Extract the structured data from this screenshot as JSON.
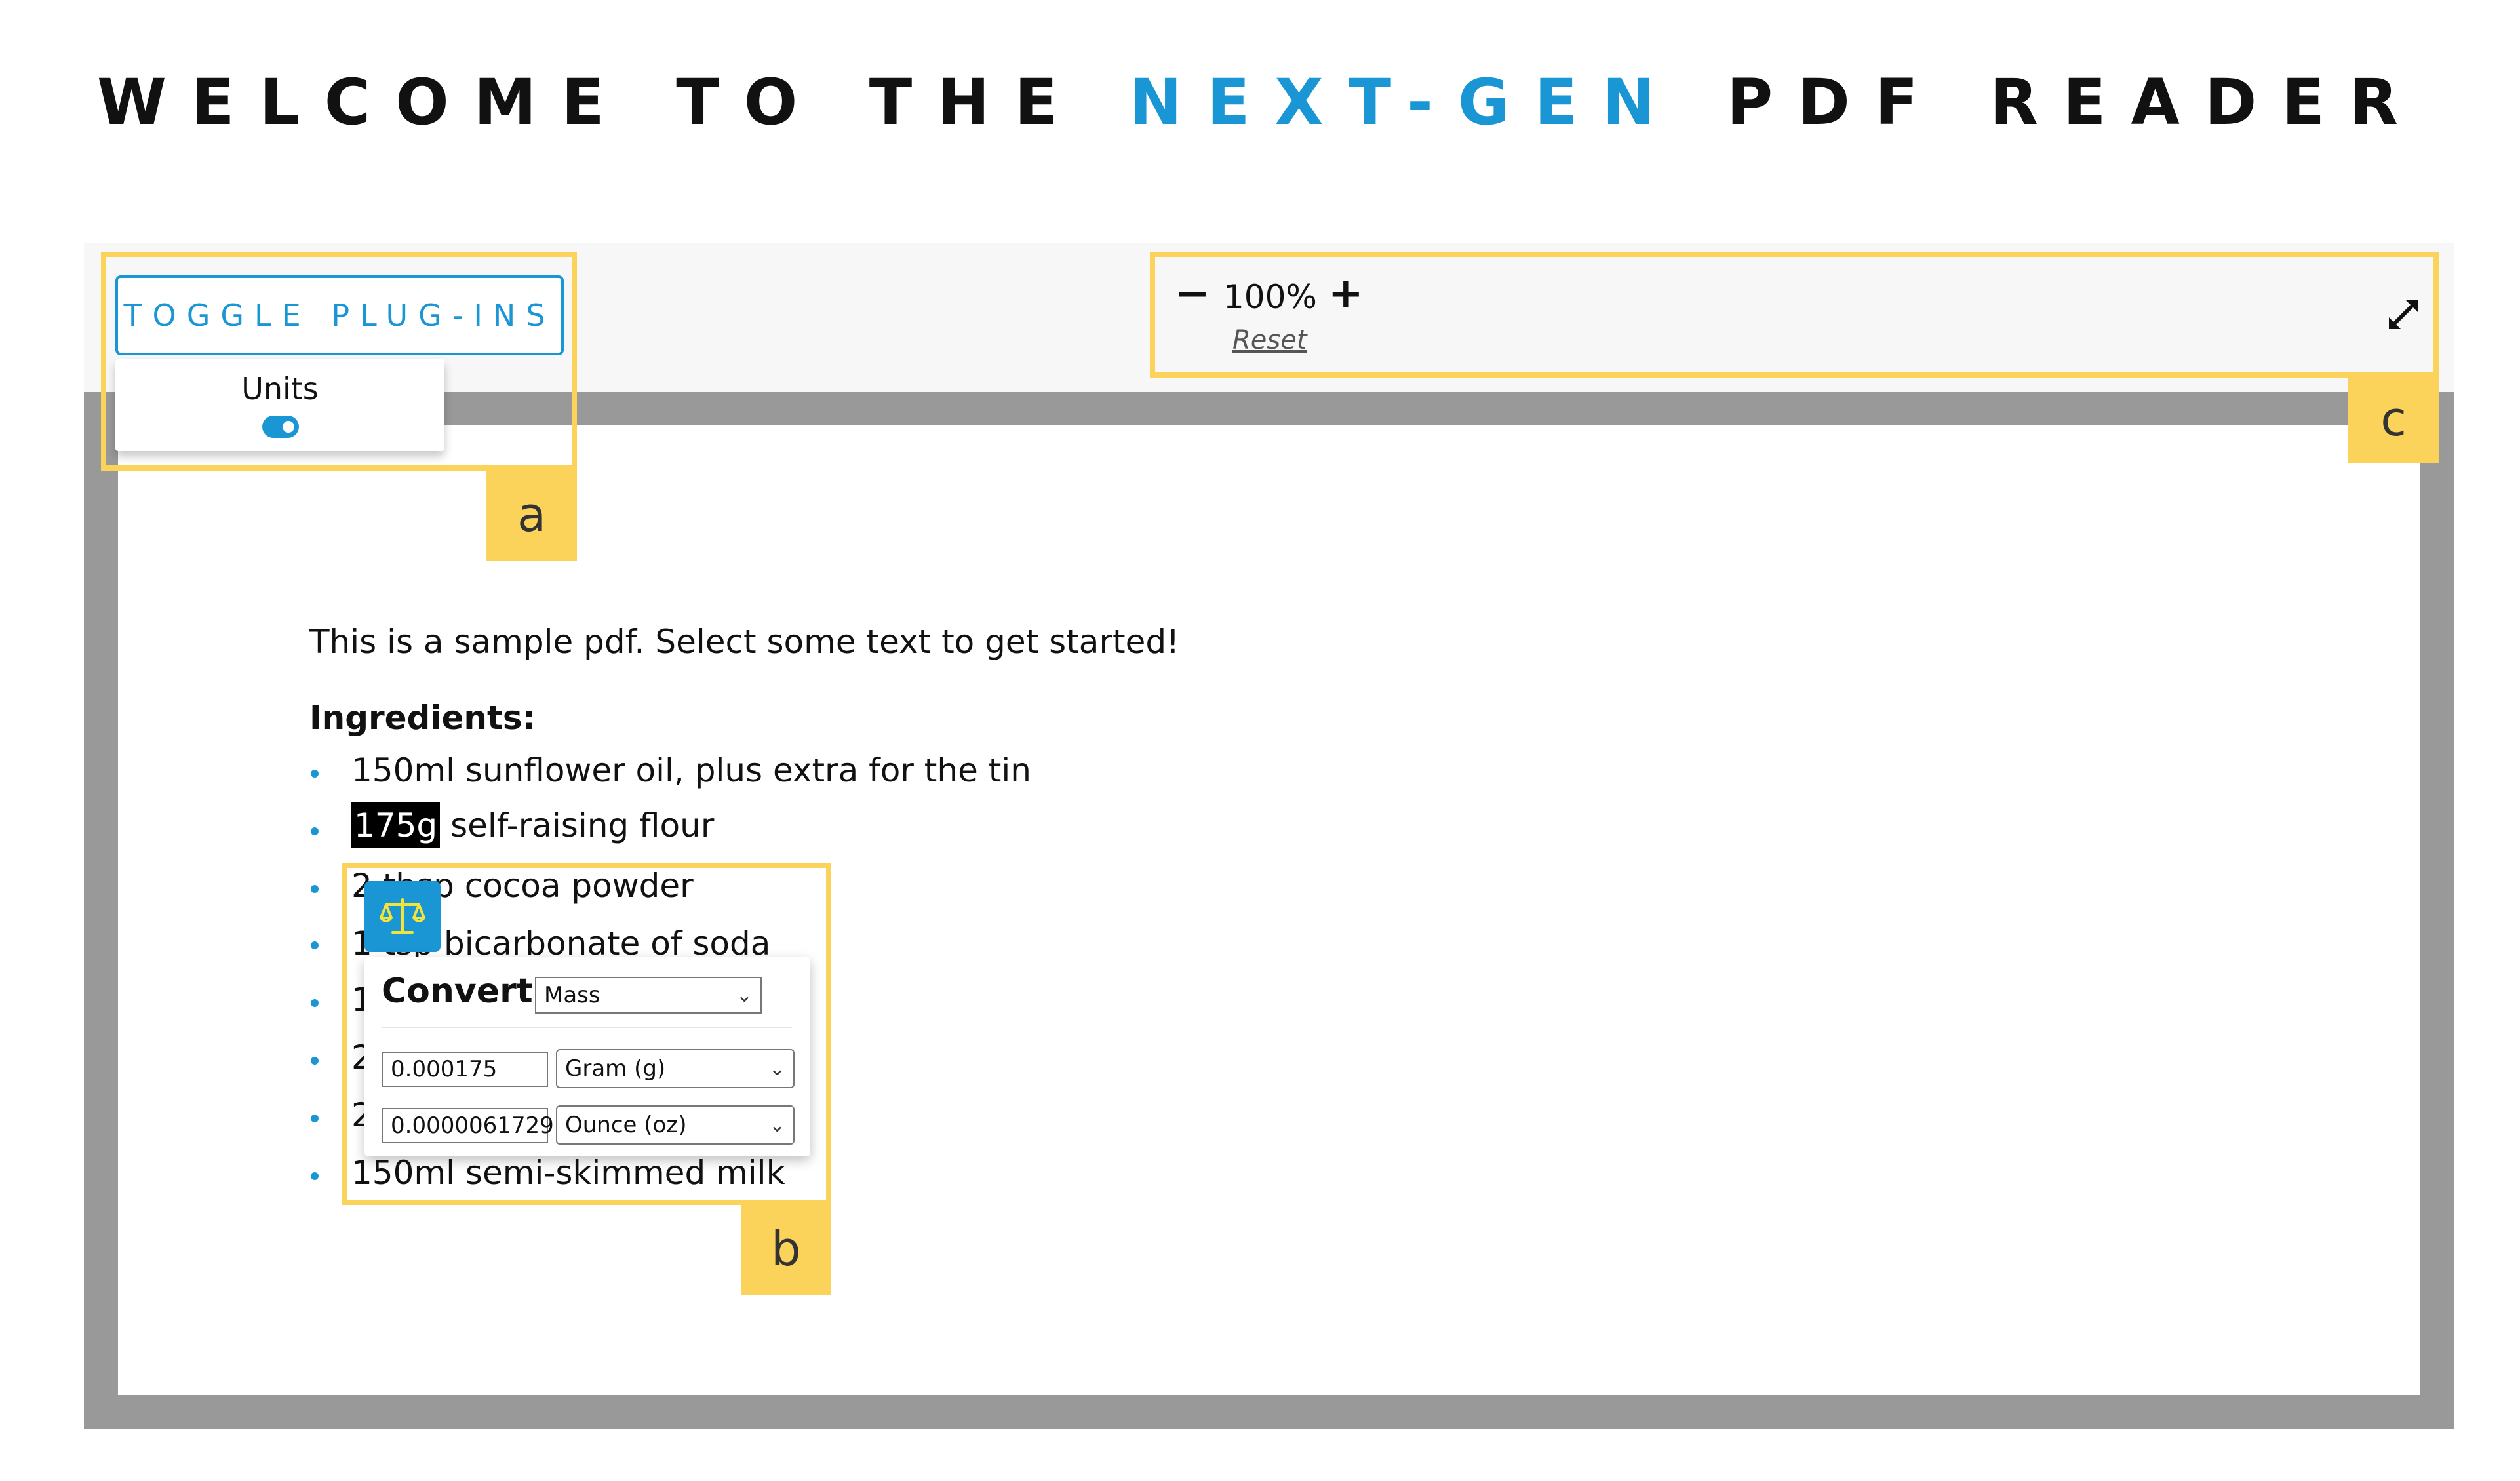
{
  "title": {
    "part1": "WELCOME TO THE ",
    "accent": "NEXT-GEN",
    "part2": " PDF READER"
  },
  "toolbar": {
    "toggle_plugins_label": "TOGGLE PLUG-INS",
    "zoom_minus": "−",
    "zoom_plus": "+",
    "zoom_value": "100%",
    "zoom_reset": "Reset",
    "fullscreen_icon": "expand-arrows-icon"
  },
  "plugins_menu": {
    "units_label": "Units",
    "units_enabled": true
  },
  "callouts": {
    "a": "a",
    "b": "b",
    "c": "c"
  },
  "document": {
    "intro": "This is a sample pdf. Select some text to get started!",
    "ingredients_heading": "Ingredients:",
    "items": [
      "150ml sunflower oil, plus extra for the tin",
      "self-raising flour",
      "2 tbsp cocoa powder",
      "1 tsp bicarbonate of soda",
      "1",
      "2",
      "2",
      "150ml semi-skimmed milk"
    ],
    "selected_text": "175g"
  },
  "converter": {
    "icon": "scale-icon",
    "title": "Convert",
    "type": "Mass",
    "value1": "0.000175",
    "unit1": "Gram (g)",
    "value2": "0.0000061729",
    "unit2": "Ounce (oz)"
  },
  "colors": {
    "accent": "#1a96d4",
    "callout": "#fbd35a",
    "viewer_bg": "#999999",
    "toolbar_bg": "#f7f7f7"
  }
}
